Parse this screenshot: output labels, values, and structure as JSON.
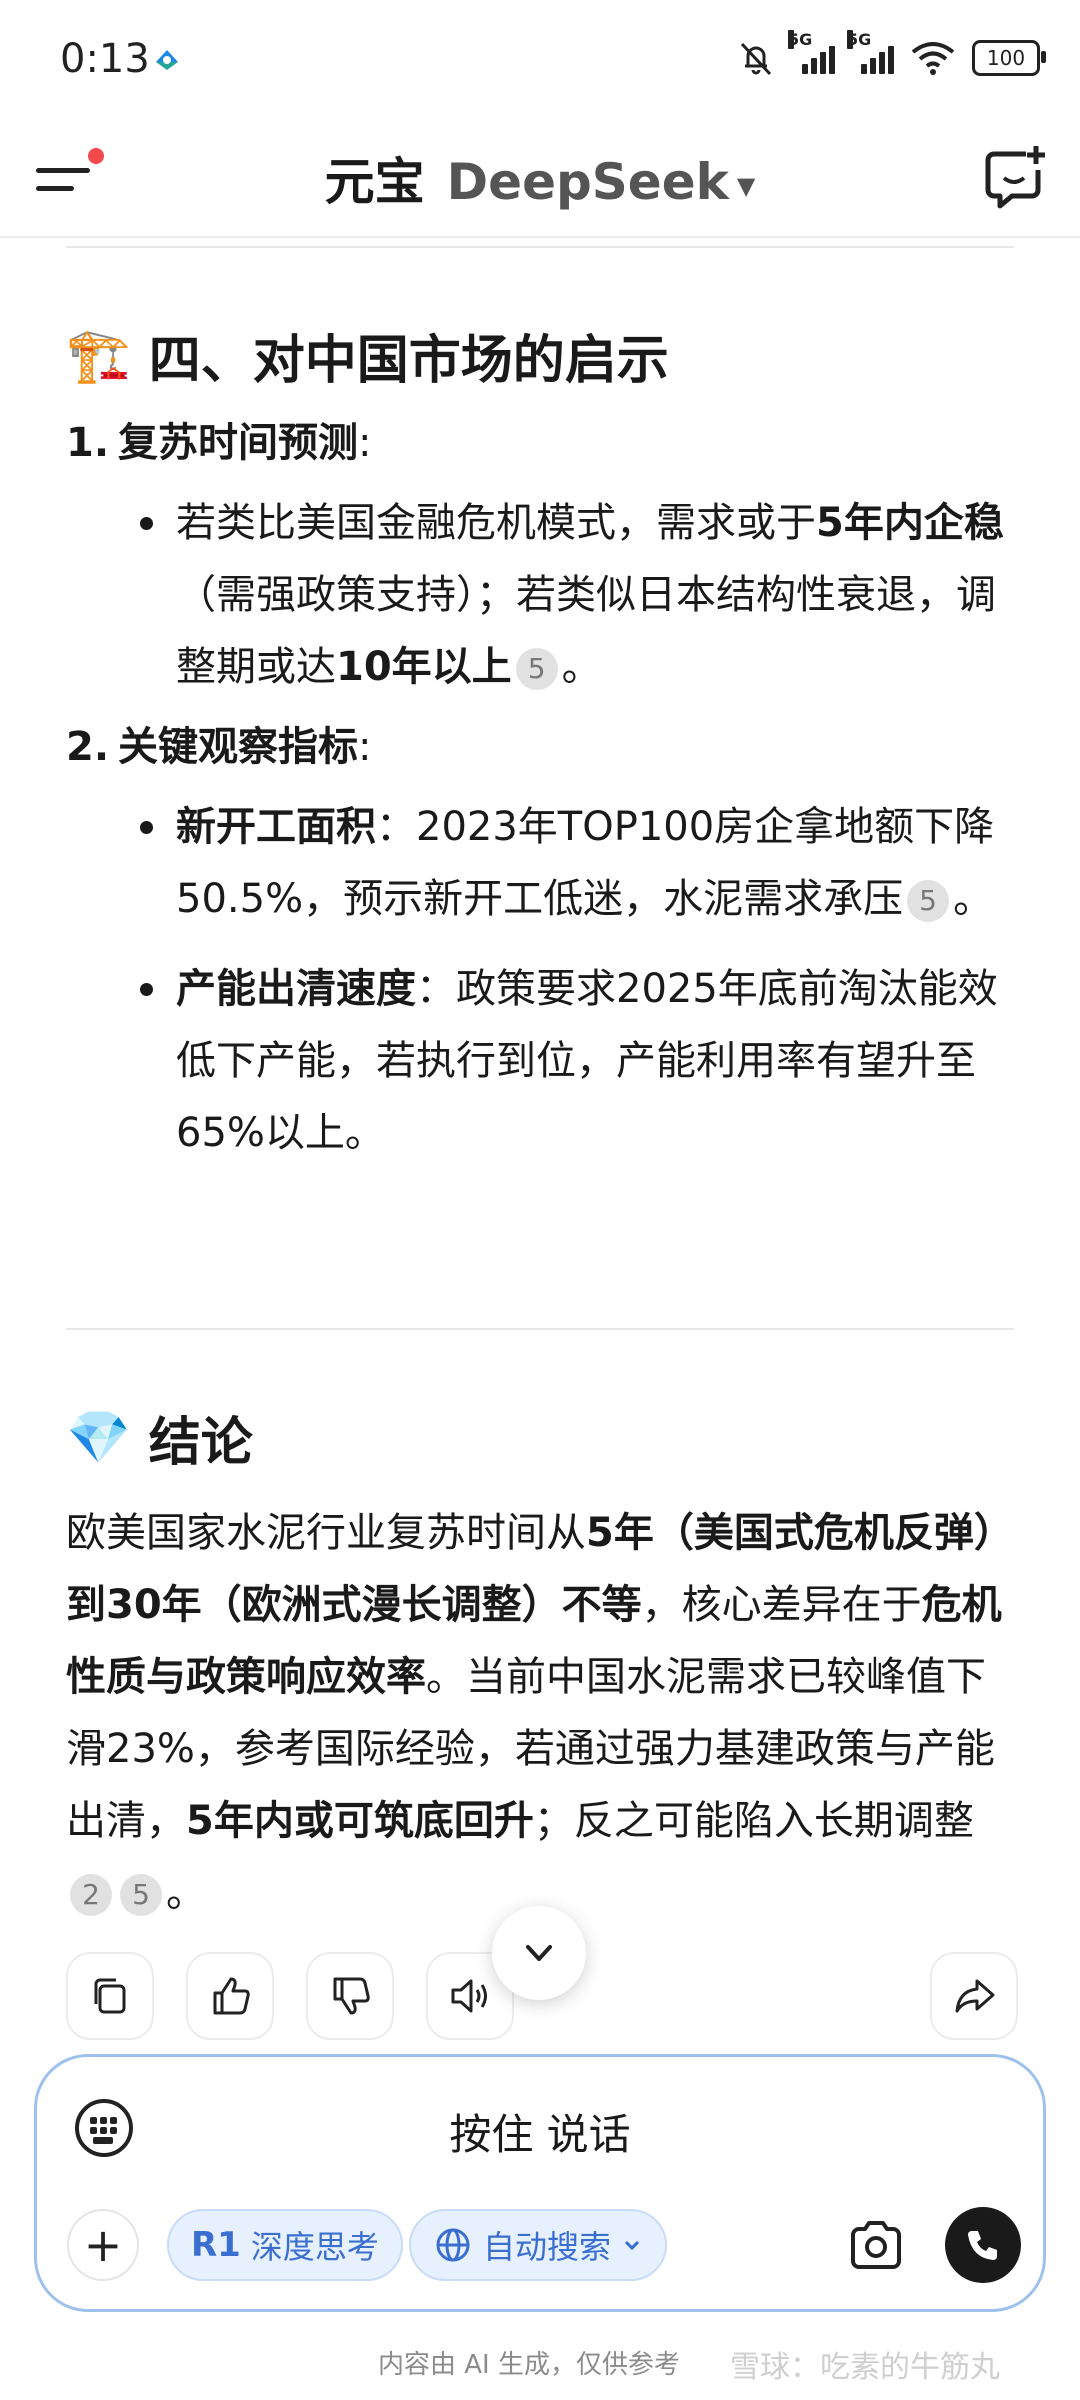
{
  "status_bar": {
    "time": "0:13",
    "net1": "5G",
    "net2": "5G",
    "battery": "100"
  },
  "header": {
    "brand": "元宝",
    "model": "DeepSeek"
  },
  "section1": {
    "emoji": "🏗️",
    "title": "四、对中国市场的启示",
    "items": [
      {
        "num": "1.",
        "label": "复苏时间预测",
        "bullets": [
          {
            "t1": "若类比美国金融危机模式，需求或于",
            "b1": "5年内企稳",
            "t2": "（需强政策支持）；若类似日本结构性衰退，调整期或达",
            "b2": "10年以上",
            "ref": "5",
            "end": "。"
          }
        ]
      },
      {
        "num": "2.",
        "label": "关键观察指标",
        "bullets": [
          {
            "b1": "新开工面积",
            "t1": "：2023年TOP100房企拿地额下降50.5%，预示新开工低迷，水泥需求承压",
            "ref": "5",
            "end": "。"
          },
          {
            "b1": "产能出清速度",
            "t1": "：政策要求2025年底前淘汰能效低下产能，若执行到位，产能利用率有望升至65%以上。"
          }
        ]
      }
    ]
  },
  "section2": {
    "emoji": "💎",
    "title": "结论",
    "p": {
      "t1": "欧美国家水泥行业复苏时间从",
      "b1": "5年（美国式危机反弹）到30年（欧洲式漫长调整）不等",
      "t2": "，核心差异在于",
      "b2": "危机性质与政策响应效率",
      "t3": "。当前中国水泥需求已较峰值下滑23%，参考国际经验，若通过强力基建政策与产能出清，",
      "b3": "5年内或可筑底回升",
      "t4": "；反之可能陷入长期调整",
      "ref1": "2",
      "ref2": "5",
      "end": "。"
    }
  },
  "input": {
    "hold_to_talk": "按住 说话",
    "chip_r1": "R1",
    "chip_deep": "深度思考",
    "chip_search": "自动搜索"
  },
  "footer": {
    "ai_note": "内容由 AI 生成，仅供参考",
    "watermark": "雪球：吃素的牛筋丸"
  }
}
